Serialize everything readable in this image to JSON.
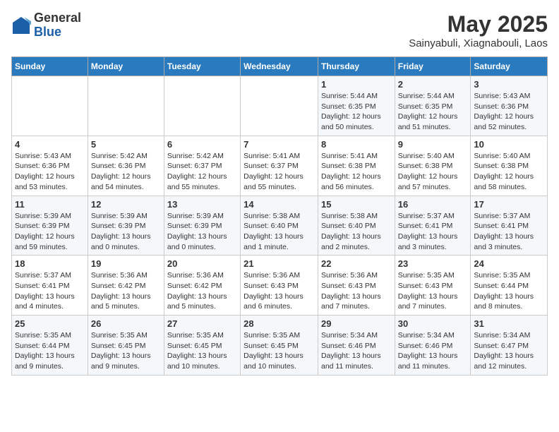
{
  "header": {
    "logo_general": "General",
    "logo_blue": "Blue",
    "month": "May 2025",
    "location": "Sainyabuli, Xiagnabouli, Laos"
  },
  "weekdays": [
    "Sunday",
    "Monday",
    "Tuesday",
    "Wednesday",
    "Thursday",
    "Friday",
    "Saturday"
  ],
  "weeks": [
    [
      {
        "day": "",
        "info": ""
      },
      {
        "day": "",
        "info": ""
      },
      {
        "day": "",
        "info": ""
      },
      {
        "day": "",
        "info": ""
      },
      {
        "day": "1",
        "info": "Sunrise: 5:44 AM\nSunset: 6:35 PM\nDaylight: 12 hours\nand 50 minutes."
      },
      {
        "day": "2",
        "info": "Sunrise: 5:44 AM\nSunset: 6:35 PM\nDaylight: 12 hours\nand 51 minutes."
      },
      {
        "day": "3",
        "info": "Sunrise: 5:43 AM\nSunset: 6:36 PM\nDaylight: 12 hours\nand 52 minutes."
      }
    ],
    [
      {
        "day": "4",
        "info": "Sunrise: 5:43 AM\nSunset: 6:36 PM\nDaylight: 12 hours\nand 53 minutes."
      },
      {
        "day": "5",
        "info": "Sunrise: 5:42 AM\nSunset: 6:36 PM\nDaylight: 12 hours\nand 54 minutes."
      },
      {
        "day": "6",
        "info": "Sunrise: 5:42 AM\nSunset: 6:37 PM\nDaylight: 12 hours\nand 55 minutes."
      },
      {
        "day": "7",
        "info": "Sunrise: 5:41 AM\nSunset: 6:37 PM\nDaylight: 12 hours\nand 55 minutes."
      },
      {
        "day": "8",
        "info": "Sunrise: 5:41 AM\nSunset: 6:38 PM\nDaylight: 12 hours\nand 56 minutes."
      },
      {
        "day": "9",
        "info": "Sunrise: 5:40 AM\nSunset: 6:38 PM\nDaylight: 12 hours\nand 57 minutes."
      },
      {
        "day": "10",
        "info": "Sunrise: 5:40 AM\nSunset: 6:38 PM\nDaylight: 12 hours\nand 58 minutes."
      }
    ],
    [
      {
        "day": "11",
        "info": "Sunrise: 5:39 AM\nSunset: 6:39 PM\nDaylight: 12 hours\nand 59 minutes."
      },
      {
        "day": "12",
        "info": "Sunrise: 5:39 AM\nSunset: 6:39 PM\nDaylight: 13 hours\nand 0 minutes."
      },
      {
        "day": "13",
        "info": "Sunrise: 5:39 AM\nSunset: 6:39 PM\nDaylight: 13 hours\nand 0 minutes."
      },
      {
        "day": "14",
        "info": "Sunrise: 5:38 AM\nSunset: 6:40 PM\nDaylight: 13 hours\nand 1 minute."
      },
      {
        "day": "15",
        "info": "Sunrise: 5:38 AM\nSunset: 6:40 PM\nDaylight: 13 hours\nand 2 minutes."
      },
      {
        "day": "16",
        "info": "Sunrise: 5:37 AM\nSunset: 6:41 PM\nDaylight: 13 hours\nand 3 minutes."
      },
      {
        "day": "17",
        "info": "Sunrise: 5:37 AM\nSunset: 6:41 PM\nDaylight: 13 hours\nand 3 minutes."
      }
    ],
    [
      {
        "day": "18",
        "info": "Sunrise: 5:37 AM\nSunset: 6:41 PM\nDaylight: 13 hours\nand 4 minutes."
      },
      {
        "day": "19",
        "info": "Sunrise: 5:36 AM\nSunset: 6:42 PM\nDaylight: 13 hours\nand 5 minutes."
      },
      {
        "day": "20",
        "info": "Sunrise: 5:36 AM\nSunset: 6:42 PM\nDaylight: 13 hours\nand 5 minutes."
      },
      {
        "day": "21",
        "info": "Sunrise: 5:36 AM\nSunset: 6:43 PM\nDaylight: 13 hours\nand 6 minutes."
      },
      {
        "day": "22",
        "info": "Sunrise: 5:36 AM\nSunset: 6:43 PM\nDaylight: 13 hours\nand 7 minutes."
      },
      {
        "day": "23",
        "info": "Sunrise: 5:35 AM\nSunset: 6:43 PM\nDaylight: 13 hours\nand 7 minutes."
      },
      {
        "day": "24",
        "info": "Sunrise: 5:35 AM\nSunset: 6:44 PM\nDaylight: 13 hours\nand 8 minutes."
      }
    ],
    [
      {
        "day": "25",
        "info": "Sunrise: 5:35 AM\nSunset: 6:44 PM\nDaylight: 13 hours\nand 9 minutes."
      },
      {
        "day": "26",
        "info": "Sunrise: 5:35 AM\nSunset: 6:45 PM\nDaylight: 13 hours\nand 9 minutes."
      },
      {
        "day": "27",
        "info": "Sunrise: 5:35 AM\nSunset: 6:45 PM\nDaylight: 13 hours\nand 10 minutes."
      },
      {
        "day": "28",
        "info": "Sunrise: 5:35 AM\nSunset: 6:45 PM\nDaylight: 13 hours\nand 10 minutes."
      },
      {
        "day": "29",
        "info": "Sunrise: 5:34 AM\nSunset: 6:46 PM\nDaylight: 13 hours\nand 11 minutes."
      },
      {
        "day": "30",
        "info": "Sunrise: 5:34 AM\nSunset: 6:46 PM\nDaylight: 13 hours\nand 11 minutes."
      },
      {
        "day": "31",
        "info": "Sunrise: 5:34 AM\nSunset: 6:47 PM\nDaylight: 13 hours\nand 12 minutes."
      }
    ]
  ]
}
